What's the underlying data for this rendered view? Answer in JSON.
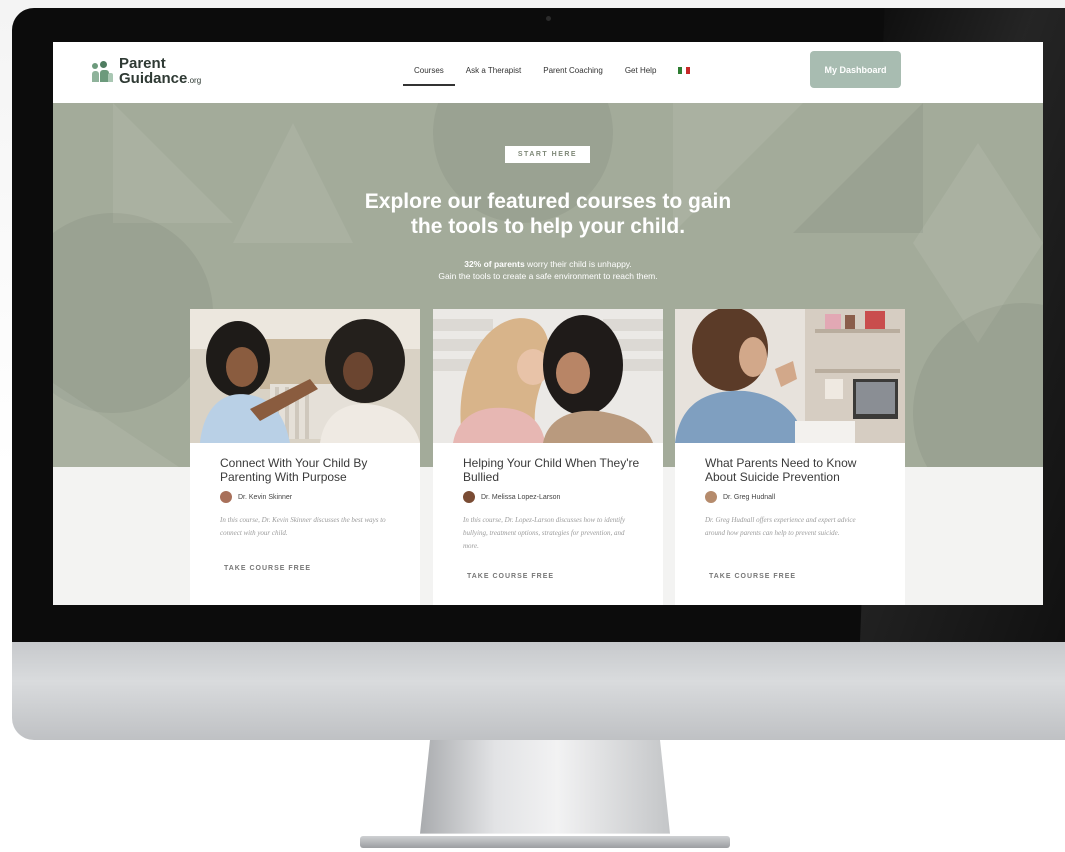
{
  "brand": {
    "name_line1": "Parent",
    "name_line2": "Guidance",
    "name_suffix": ".org"
  },
  "nav": {
    "items": [
      {
        "label": "Courses",
        "active": true
      },
      {
        "label": "Ask a Therapist",
        "active": false
      },
      {
        "label": "Parent Coaching",
        "active": false
      },
      {
        "label": "Get Help",
        "active": false
      }
    ],
    "language_flag": "mexico-flag-icon",
    "dashboard_label": "My Dashboard"
  },
  "hero": {
    "badge": "START HERE",
    "headline_line1": "Explore our featured courses to gain",
    "headline_line2": "the tools to help your child.",
    "stat_bold": "32% of parents",
    "stat_rest": " worry their child is unhappy.",
    "subline2": "Gain the tools to create a safe environment to reach them."
  },
  "courses": [
    {
      "title": "Connect With Your Child By Parenting With Purpose",
      "author": "Dr. Kevin Skinner",
      "description": "In this course, Dr. Kevin Skinner discusses the best ways to connect with your child.",
      "cta": "TAKE COURSE FREE"
    },
    {
      "title": "Helping Your Child When They're Bullied",
      "author": "Dr. Melissa Lopez-Larson",
      "description": "In this course, Dr. Lopez-Larson discusses how to identify bullying, treatment options, strategies for prevention, and more.",
      "cta": "TAKE COURSE FREE"
    },
    {
      "title": "What Parents Need to Know About Suicide Prevention",
      "author": "Dr. Greg Hudnall",
      "description": "Dr. Greg Hudnall offers experience and expert advice around how parents can help to prevent suicide.",
      "cta": "TAKE COURSE FREE"
    }
  ],
  "colors": {
    "hero_bg": "#a3ab9a",
    "accent_button": "#a8bcb1",
    "logo_green": "#6c9a7c"
  }
}
